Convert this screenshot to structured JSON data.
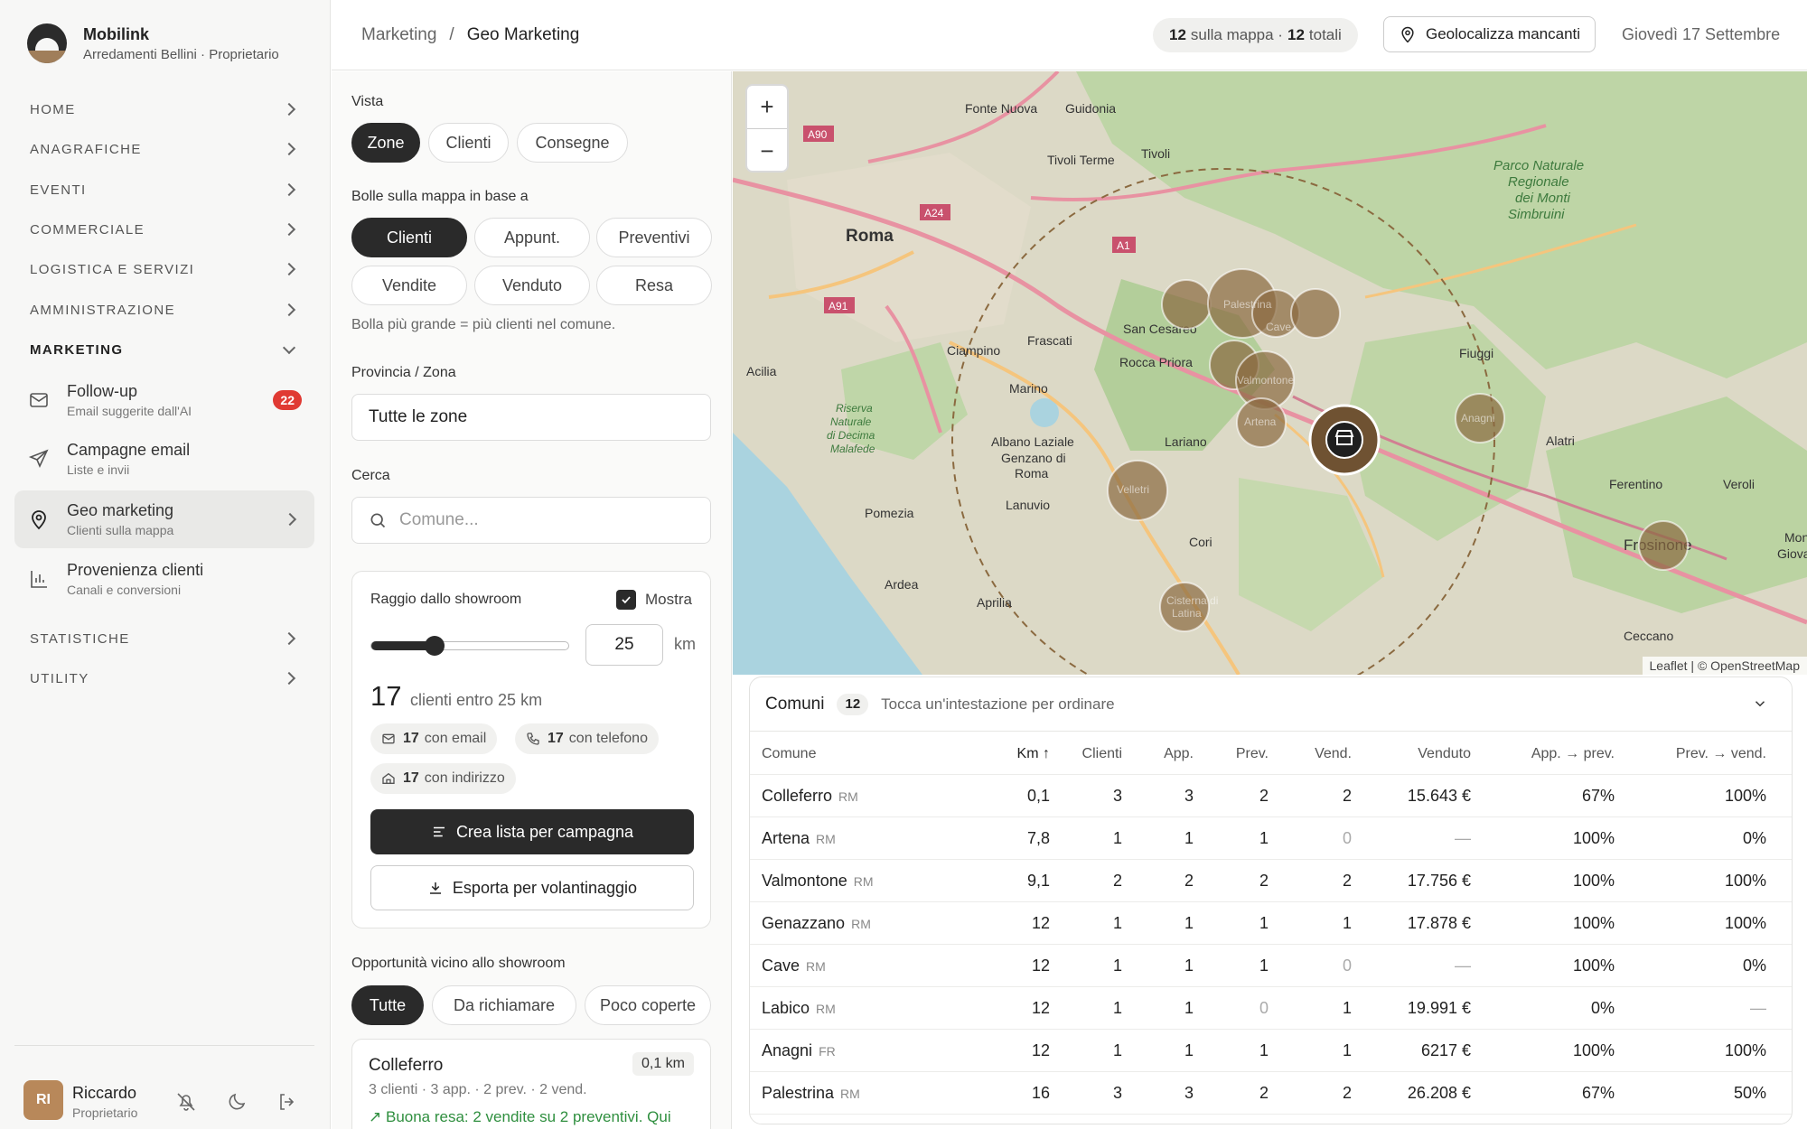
{
  "brand": {
    "name": "Mobilink",
    "sub": "Arredamenti Bellini · Proprietario"
  },
  "nav": [
    {
      "label": "HOME"
    },
    {
      "label": "ANAGRAFICHE"
    },
    {
      "label": "EVENTI"
    },
    {
      "label": "COMMERCIALE"
    },
    {
      "label": "LOGISTICA E SERVIZI"
    },
    {
      "label": "AMMINISTRAZIONE"
    },
    {
      "label": "MARKETING"
    },
    {
      "label": "STATISTICHE"
    },
    {
      "label": "UTILITY"
    }
  ],
  "marketing_items": [
    {
      "title": "Follow-up",
      "desc": "Email suggerite dall'AI",
      "badge": "22",
      "icon": "mail-icon"
    },
    {
      "title": "Campagne email",
      "desc": "Liste e invii",
      "icon": "send-icon"
    },
    {
      "title": "Geo marketing",
      "desc": "Clienti sulla mappa",
      "icon": "pin-icon"
    },
    {
      "title": "Provenienza clienti",
      "desc": "Canali e conversioni",
      "icon": "bar-chart-icon"
    }
  ],
  "user": {
    "initials": "RI",
    "name": "Riccardo",
    "role": "Proprietario"
  },
  "header": {
    "crumb_parent": "Marketing",
    "crumb_sep": "/",
    "crumb_current": "Geo Marketing",
    "map_count": "12",
    "map_count_label": "sulla mappa ·",
    "total_count": "12",
    "total_label": "totali",
    "geo_button": "Geolocalizza mancanti",
    "date": "Giovedì 17 Settembre"
  },
  "panel": {
    "vista_label": "Vista",
    "vista_options": [
      "Zone",
      "Clienti",
      "Consegne"
    ],
    "bolle_label": "Bolle sulla mappa in base a",
    "bolle_options": [
      "Clienti",
      "Appunt.",
      "Preventivi",
      "Vendite",
      "Venduto",
      "Resa"
    ],
    "bolle_hint": "Bolla più grande = più clienti nel comune.",
    "provincia_label": "Provincia / Zona",
    "provincia_value": "Tutte le zone",
    "cerca_label": "Cerca",
    "cerca_placeholder": "Comune...",
    "raggio": {
      "title": "Raggio dallo showroom",
      "mostra": "Mostra",
      "value": "25",
      "unit": "km",
      "slider_fraction": 0.32,
      "count": "17",
      "count_label": "clienti entro 25 km",
      "email_count": "17",
      "email_label": "con email",
      "phone_count": "17",
      "phone_label": "con telefono",
      "addr_count": "17",
      "addr_label": "con indirizzo",
      "create_button": "Crea lista per campagna",
      "export_button": "Esporta per volantinaggio"
    },
    "opp_label": "Opportunità vicino allo showroom",
    "opp_filters": [
      "Tutte",
      "Da richiamare",
      "Poco coperte"
    ],
    "opp_card": {
      "name": "Colleferro",
      "km": "0,1 km",
      "meta": "3 clienti · 3 app. · 2 prev. · 2 vend.",
      "note": "Buona resa: 2 vendite su 2 preventivi. Qui"
    }
  },
  "map": {
    "zoom_in": "+",
    "zoom_out": "−",
    "attribution": "Leaflet | © OpenStreetMap",
    "labels": {
      "roma": "Roma",
      "fonte_nuova": "Fonte Nuova",
      "guidonia": "Guidonia",
      "tivoli_terme": "Tivoli Terme",
      "tivoli": "Tivoli",
      "parco": "Parco Naturale",
      "parco2": "Regionale",
      "parco3": "dei Monti",
      "parco4": "Simbruini",
      "ciampino": "Ciampino",
      "frascati": "Frascati",
      "rocca_priora": "Rocca Priora",
      "san_cesareo": "San Cesareo",
      "acilia": "Acilia",
      "marino": "Marino",
      "riserva": "Riserva",
      "riserva2": "Naturale",
      "riserva3": "di Decima",
      "riserva4": "Malafede",
      "albano": "Albano Laziale",
      "genzano": "Genzano di",
      "genzano2": "Roma",
      "lanuvio": "Lanuvio",
      "lariano": "Lariano",
      "pomezia": "Pomezia",
      "ardea": "Ardea",
      "aprilia": "Aprilia",
      "cori": "Cori",
      "fiuggi": "Fiuggi",
      "alatri": "Alatri",
      "ferentino": "Ferentino",
      "veroli": "Veroli",
      "frosinone": "Frosinone",
      "ceccano": "Ceccano",
      "mon": "Mon",
      "giovanni": "Giovanni",
      "a90": "A90",
      "a24": "A24",
      "a1": "A1",
      "a91": "A91",
      "palestrina": "Palestrina",
      "cave": "Cave",
      "valmontone": "Valmontone",
      "artena": "Artena",
      "anagni": "Anagni",
      "velletri": "Velletri",
      "cisterna": "Cisterna di",
      "cisterna2": "Latina"
    }
  },
  "table": {
    "title": "Comuni",
    "count": "12",
    "hint": "Tocca un'intestazione per ordinare",
    "columns": [
      "Comune",
      "Km ↑",
      "Clienti",
      "App.",
      "Prev.",
      "Vend.",
      "Venduto",
      "App. → prev.",
      "Prev. → vend."
    ],
    "rows": [
      {
        "comune": "Colleferro",
        "prov": "RM",
        "km": "0,1",
        "clienti": "3",
        "app": "3",
        "prev": "2",
        "vend": "2",
        "venduto": "15.643 €",
        "app_prev": "67%",
        "prev_vend": "100%"
      },
      {
        "comune": "Artena",
        "prov": "RM",
        "km": "7,8",
        "clienti": "1",
        "app": "1",
        "prev": "1",
        "vend": "0",
        "venduto": "—",
        "app_prev": "100%",
        "prev_vend": "0%"
      },
      {
        "comune": "Valmontone",
        "prov": "RM",
        "km": "9,1",
        "clienti": "2",
        "app": "2",
        "prev": "2",
        "vend": "2",
        "venduto": "17.756 €",
        "app_prev": "100%",
        "prev_vend": "100%"
      },
      {
        "comune": "Genazzano",
        "prov": "RM",
        "km": "12",
        "clienti": "1",
        "app": "1",
        "prev": "1",
        "vend": "1",
        "venduto": "17.878 €",
        "app_prev": "100%",
        "prev_vend": "100%"
      },
      {
        "comune": "Cave",
        "prov": "RM",
        "km": "12",
        "clienti": "1",
        "app": "1",
        "prev": "1",
        "vend": "0",
        "venduto": "—",
        "app_prev": "100%",
        "prev_vend": "0%"
      },
      {
        "comune": "Labico",
        "prov": "RM",
        "km": "12",
        "clienti": "1",
        "app": "1",
        "prev": "0",
        "vend": "1",
        "venduto": "19.991 €",
        "app_prev": "0%",
        "prev_vend": "—"
      },
      {
        "comune": "Anagni",
        "prov": "FR",
        "km": "12",
        "clienti": "1",
        "app": "1",
        "prev": "1",
        "vend": "1",
        "venduto": "6217 €",
        "app_prev": "100%",
        "prev_vend": "100%"
      },
      {
        "comune": "Palestrina",
        "prov": "RM",
        "km": "16",
        "clienti": "3",
        "app": "3",
        "prev": "2",
        "vend": "2",
        "venduto": "26.208 €",
        "app_prev": "67%",
        "prev_vend": "50%"
      }
    ]
  },
  "colors": {
    "accent_dark": "#2a2a2a",
    "bubble": "#8a6a40",
    "badge": "#e03a33",
    "positive": "#2f8f3f"
  }
}
